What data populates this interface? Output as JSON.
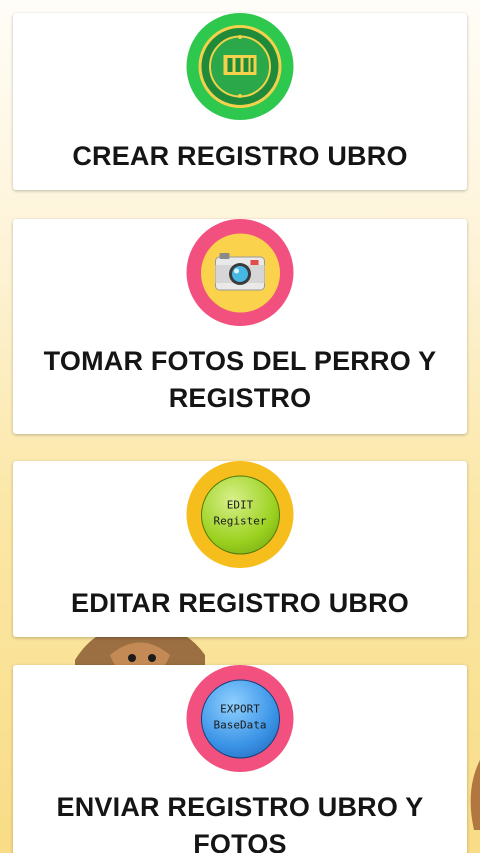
{
  "menu": {
    "items": [
      {
        "title": "CREAR REGISTRO UBRO",
        "icon": "ubro-logo-icon"
      },
      {
        "title": "TOMAR FOTOS DEL PERRO Y REGISTRO",
        "icon": "camera-icon"
      },
      {
        "title": "EDITAR REGISTRO UBRO",
        "icon": "edit-register-icon",
        "badge_line1": "EDIT",
        "badge_line2": "Register"
      },
      {
        "title": "ENVIAR REGISTRO UBRO Y FOTOS",
        "icon": "export-database-icon",
        "badge_line1": "EXPORT",
        "badge_line2": "BaseData"
      }
    ]
  },
  "colors": {
    "green_circle": "#2ec84e",
    "pink_circle": "#f2517f",
    "yellow_circle": "#f6be1c",
    "background_top": "#fffdf8",
    "background_bottom": "#f8dc86"
  }
}
